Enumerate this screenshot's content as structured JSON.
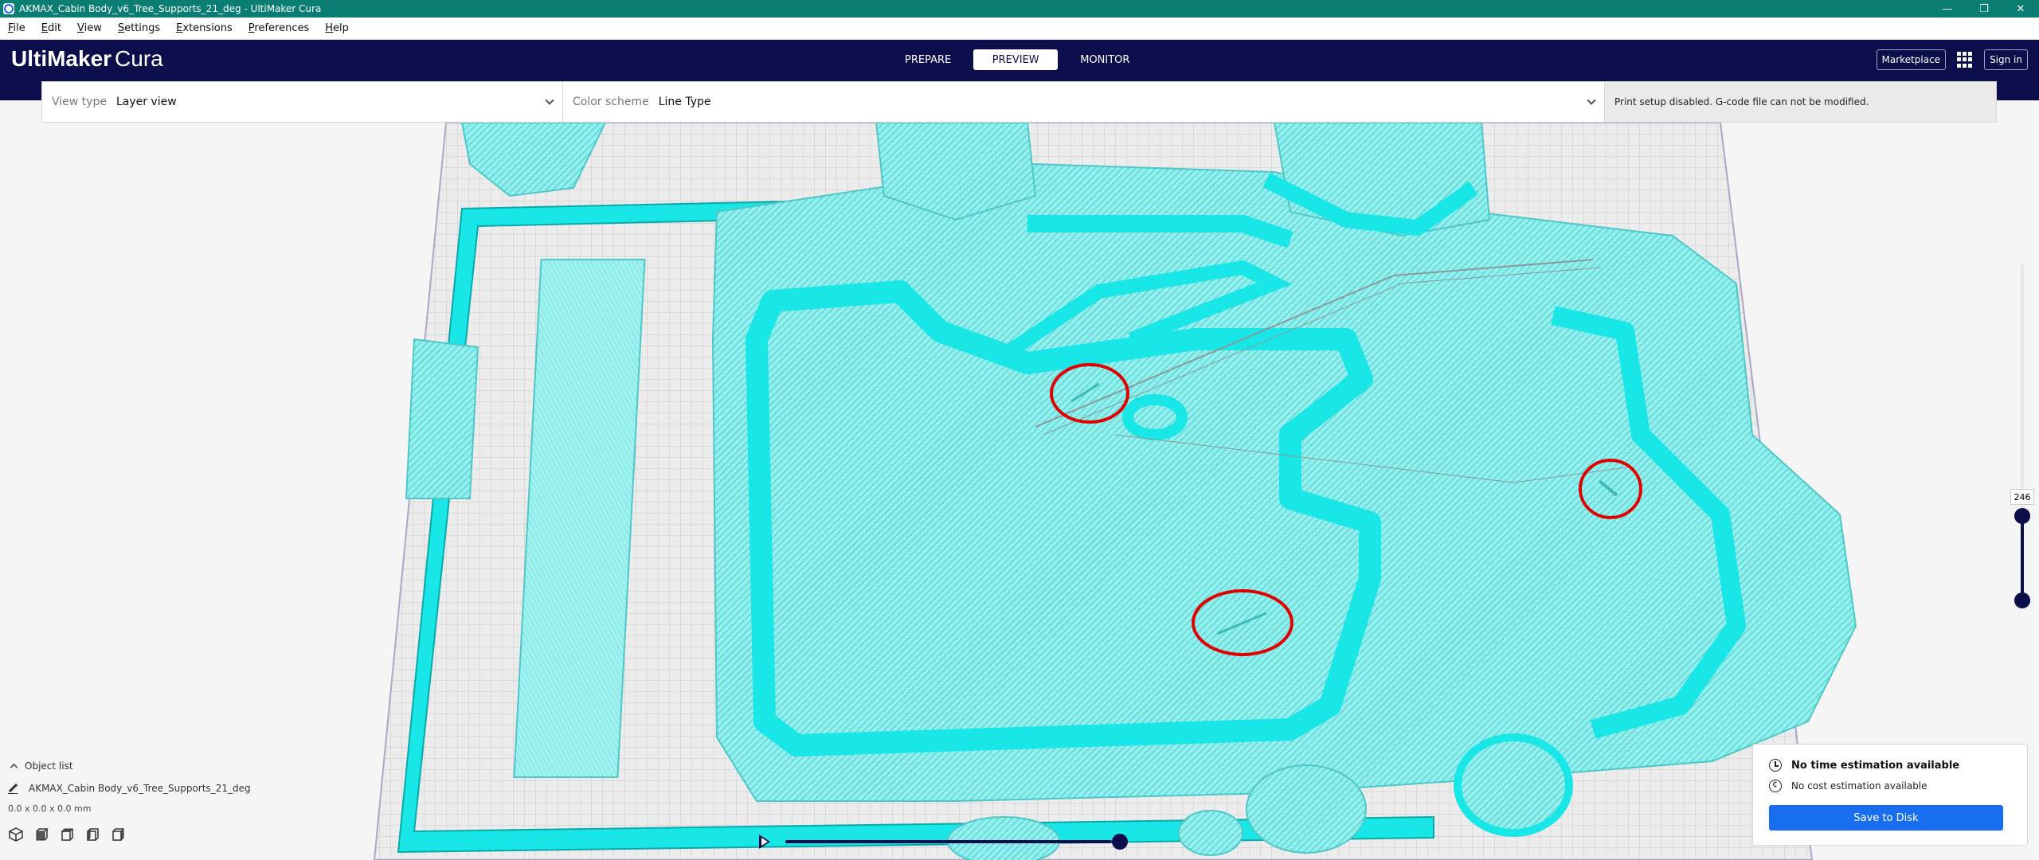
{
  "window": {
    "title": "AKMAX_Cabin Body_v6_Tree_Supports_21_deg - UltiMaker Cura",
    "minimize": "—",
    "restore": "❐",
    "close": "✕"
  },
  "menu": [
    "File",
    "Edit",
    "View",
    "Settings",
    "Extensions",
    "Preferences",
    "Help"
  ],
  "header": {
    "brand_bold": "UltiMaker",
    "brand_light": "Cura",
    "stages": [
      "PREPARE",
      "PREVIEW",
      "MONITOR"
    ],
    "active_stage": "PREVIEW",
    "marketplace": "Marketplace",
    "sign_in": "Sign in"
  },
  "view_toolbar": {
    "view_type_label": "View type",
    "view_type_value": "Layer view",
    "color_scheme_label": "Color scheme",
    "color_scheme_value": "Line Type",
    "message": "Print setup disabled. G-code file can not be modified."
  },
  "layer_slider": {
    "current_layer": "246"
  },
  "object_list": {
    "toggle_label": "Object list",
    "object_name": "AKMAX_Cabin Body_v6_Tree_Supports_21_deg",
    "dimensions": "0.0 x 0.0 x 0.0 mm"
  },
  "print_info": {
    "time": "No time estimation available",
    "cost": "No cost estimation available",
    "save_button": "Save to Disk"
  },
  "colors": {
    "accent": "#196ef0",
    "header_bg": "#0b0e4a",
    "titlebar_bg": "#0b7e73",
    "model_cyan": "#19e6e6",
    "annotation_red": "#e00000"
  }
}
